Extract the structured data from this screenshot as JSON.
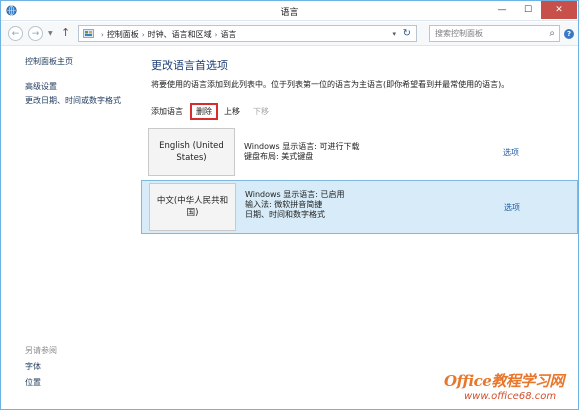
{
  "window": {
    "title": "语言",
    "icons": {
      "app": "clock-globe-icon",
      "minimize": "minimize-icon",
      "maximize": "maximize-icon",
      "close": "close-icon"
    }
  },
  "navbar": {
    "breadcrumbs": [
      "控制面板",
      "时钟、语言和区域",
      "语言"
    ],
    "search_placeholder": "搜索控制面板",
    "icons": {
      "back": "back-arrow-icon",
      "forward": "forward-arrow-icon",
      "recent": "chevron-down-icon",
      "up": "up-arrow-icon",
      "refresh": "refresh-icon",
      "search": "search-icon",
      "help": "help-icon"
    }
  },
  "sidebar": {
    "home_link": "控制面板主页",
    "links": [
      "高级设置",
      "更改日期、时间或数字格式"
    ],
    "see_also_label": "另请参阅",
    "see_also_links": [
      "字体",
      "位置"
    ]
  },
  "main": {
    "title": "更改语言首选项",
    "description": "将要使用的语言添加到此列表中。位于列表第一位的语言为主语言(即你希望看到并最常使用的语言)。",
    "toolbar": {
      "add": "添加语言",
      "remove": "删除",
      "move_up": "上移",
      "move_down": "下移"
    },
    "languages": [
      {
        "name": "English (United States)",
        "details": [
          "Windows 显示语言: 可进行下载",
          "键盘布局: 美式键盘"
        ],
        "options": "选项",
        "selected": false
      },
      {
        "name": "中文(中华人民共和国)",
        "details": [
          "Windows 显示语言: 已启用",
          "输入法: 微软拼音简捷",
          "日期、时间和数字格式"
        ],
        "options": "选项",
        "selected": true
      }
    ]
  },
  "watermark": {
    "brand": "Office教程学习网",
    "url": "www.office68.com"
  },
  "colors": {
    "accent_title": "#1e3f75",
    "selected_row": "#d7ecf8",
    "highlight_box": "#d62e2e",
    "close_button": "#c7504a"
  }
}
